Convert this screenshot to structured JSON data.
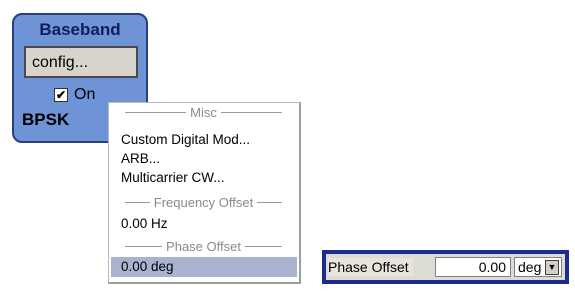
{
  "baseband": {
    "title": "Baseband",
    "config_button": "config...",
    "on_label": "On",
    "on_checked": true,
    "modulation": "BPSK"
  },
  "menu": {
    "sections": {
      "misc": "Misc",
      "frequency_offset": "Frequency Offset",
      "phase_offset": "Phase Offset"
    },
    "items": {
      "custom_digital_mod": "Custom Digital Mod...",
      "arb": "ARB...",
      "multicarrier_cw": "Multicarrier CW...",
      "frequency_value": "0.00 Hz",
      "phase_value": "0.00 deg"
    }
  },
  "phase_offset_field": {
    "label": "Phase Offset",
    "value": "0.00",
    "unit": "deg",
    "check_mark": "✔",
    "dropdown_arrow": "▼"
  },
  "colors": {
    "block_bg": "#6e93d6",
    "field_frame": "#1c2b8c",
    "menu_highlight": "#a9b2cf"
  }
}
